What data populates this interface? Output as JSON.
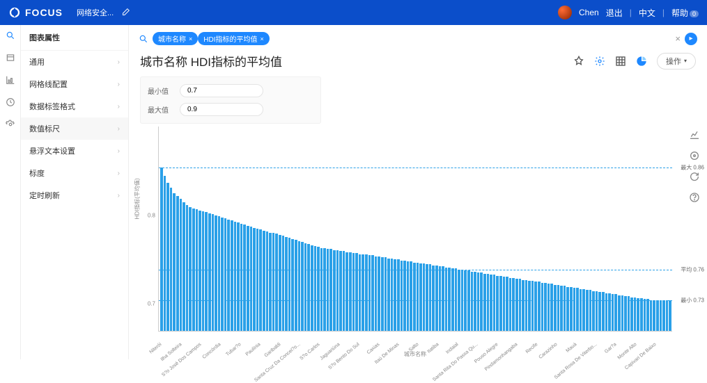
{
  "header": {
    "brand": "FOCUS",
    "breadcrumb": "网络安全...",
    "user": "Chen",
    "logout": "退出",
    "lang": "中文",
    "help": "帮助"
  },
  "panel": {
    "title": "图表属性",
    "items": [
      {
        "label": "通用"
      },
      {
        "label": "网格线配置"
      },
      {
        "label": "数据标签格式"
      },
      {
        "label": "数值标尺",
        "active": true
      },
      {
        "label": "悬浮文本设置"
      },
      {
        "label": "标度"
      },
      {
        "label": "定时刷新"
      }
    ]
  },
  "query": {
    "pills": [
      "城市名称",
      "HDI指标的平均值"
    ]
  },
  "title": "城市名称 HDI指标的平均值",
  "ops_label": "操作",
  "config": {
    "min_label": "最小值",
    "min_value": "0.7",
    "max_label": "最大值",
    "max_value": "0.9"
  },
  "chart_data": {
    "type": "bar",
    "xlabel": "城市名称",
    "ylabel": "HDI指标(平均值)",
    "ylim": [
      0.7,
      0.9
    ],
    "y_ticks": [
      0.7,
      0.8
    ],
    "reference_lines": [
      {
        "label": "最大 0.86",
        "value": 0.86
      },
      {
        "label": "平均 0.76",
        "value": 0.76
      },
      {
        "label": "最小 0.73",
        "value": 0.73
      }
    ],
    "visible_x_ticks": [
      "Niterói",
      "Ilha Solteira",
      "S?o José Dos Campos",
      "Concórdia",
      "Tubar?o",
      "Paulínia",
      "Garibaldi",
      "Santa Cruz Da Concei?o...",
      "S?o Carlos",
      "Jaguariúna",
      "S?o Bento Do Sul",
      "Caxias",
      "Itaú De Minas",
      "Salto",
      "Itatiba",
      "Indaial",
      "Santa Rita Do Passa Qu...",
      "Pouso Alegre",
      "Pindamonhangaba",
      "Recife",
      "Carazinho",
      "Mauá",
      "Santa Rosa De Viterbo...",
      "Gar?a",
      "Monte Alto",
      "Capivari De Baixo"
    ],
    "values": [
      0.86,
      0.852,
      0.845,
      0.84,
      0.835,
      0.832,
      0.829,
      0.826,
      0.823,
      0.821,
      0.82,
      0.819,
      0.818,
      0.817,
      0.816,
      0.815,
      0.814,
      0.813,
      0.812,
      0.811,
      0.81,
      0.809,
      0.808,
      0.807,
      0.806,
      0.805,
      0.804,
      0.803,
      0.802,
      0.801,
      0.8,
      0.799,
      0.798,
      0.797,
      0.796,
      0.796,
      0.795,
      0.794,
      0.793,
      0.792,
      0.791,
      0.79,
      0.789,
      0.788,
      0.787,
      0.786,
      0.785,
      0.784,
      0.783,
      0.782,
      0.781,
      0.781,
      0.78,
      0.78,
      0.779,
      0.779,
      0.778,
      0.778,
      0.777,
      0.777,
      0.776,
      0.776,
      0.775,
      0.775,
      0.775,
      0.774,
      0.774,
      0.773,
      0.773,
      0.772,
      0.772,
      0.771,
      0.771,
      0.77,
      0.77,
      0.769,
      0.769,
      0.768,
      0.768,
      0.767,
      0.767,
      0.766,
      0.766,
      0.765,
      0.765,
      0.764,
      0.764,
      0.763,
      0.763,
      0.762,
      0.762,
      0.761,
      0.761,
      0.76,
      0.76,
      0.759,
      0.759,
      0.758,
      0.758,
      0.757,
      0.757,
      0.756,
      0.756,
      0.755,
      0.755,
      0.754,
      0.754,
      0.753,
      0.753,
      0.752,
      0.752,
      0.751,
      0.751,
      0.75,
      0.75,
      0.749,
      0.749,
      0.748,
      0.748,
      0.747,
      0.747,
      0.746,
      0.746,
      0.745,
      0.745,
      0.744,
      0.744,
      0.743,
      0.743,
      0.742,
      0.742,
      0.741,
      0.741,
      0.74,
      0.74,
      0.739,
      0.739,
      0.738,
      0.738,
      0.737,
      0.737,
      0.736,
      0.736,
      0.735,
      0.735,
      0.734,
      0.734,
      0.733,
      0.733,
      0.732,
      0.732,
      0.731,
      0.731,
      0.73,
      0.73,
      0.73,
      0.73,
      0.73,
      0.73,
      0.73
    ]
  }
}
